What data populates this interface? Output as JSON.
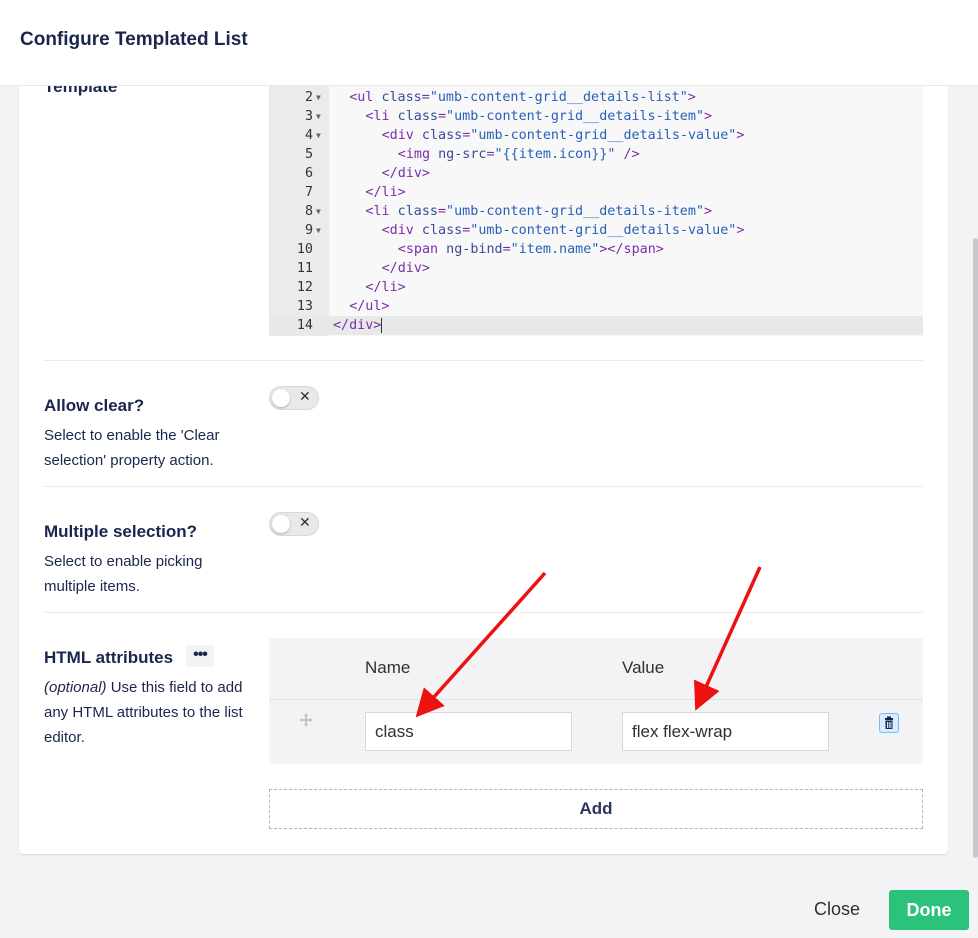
{
  "dialog": {
    "title": "Configure Templated List"
  },
  "template": {
    "label": "Template",
    "lines": [
      {
        "n": "2",
        "fold": true,
        "indent": 1,
        "parts": [
          [
            "tag",
            "<ul"
          ],
          [
            "sp",
            " "
          ],
          [
            "attr",
            "class"
          ],
          [
            "tag",
            "="
          ],
          [
            "str",
            "\"umb-content-grid__details-list\""
          ],
          [
            "tag",
            ">"
          ]
        ]
      },
      {
        "n": "3",
        "fold": true,
        "indent": 2,
        "parts": [
          [
            "tag",
            "<li"
          ],
          [
            "sp",
            " "
          ],
          [
            "attr",
            "class"
          ],
          [
            "tag",
            "="
          ],
          [
            "str",
            "\"umb-content-grid__details-item\""
          ],
          [
            "tag",
            ">"
          ]
        ]
      },
      {
        "n": "4",
        "fold": true,
        "indent": 3,
        "parts": [
          [
            "tag",
            "<div"
          ],
          [
            "sp",
            " "
          ],
          [
            "attr",
            "class"
          ],
          [
            "tag",
            "="
          ],
          [
            "str",
            "\"umb-content-grid__details-value\""
          ],
          [
            "tag",
            ">"
          ]
        ]
      },
      {
        "n": "5",
        "fold": false,
        "indent": 4,
        "parts": [
          [
            "tag",
            "<img"
          ],
          [
            "sp",
            " "
          ],
          [
            "attr",
            "ng-src"
          ],
          [
            "tag",
            "="
          ],
          [
            "str",
            "\"{{item.icon}}\""
          ],
          [
            "sp",
            " "
          ],
          [
            "tag",
            "/>"
          ]
        ]
      },
      {
        "n": "6",
        "fold": false,
        "indent": 3,
        "parts": [
          [
            "tag",
            "</div>"
          ]
        ]
      },
      {
        "n": "7",
        "fold": false,
        "indent": 2,
        "parts": [
          [
            "tag",
            "</li>"
          ]
        ]
      },
      {
        "n": "8",
        "fold": true,
        "indent": 2,
        "parts": [
          [
            "tag",
            "<li"
          ],
          [
            "sp",
            " "
          ],
          [
            "attr",
            "class"
          ],
          [
            "tag",
            "="
          ],
          [
            "str",
            "\"umb-content-grid__details-item\""
          ],
          [
            "tag",
            ">"
          ]
        ]
      },
      {
        "n": "9",
        "fold": true,
        "indent": 3,
        "parts": [
          [
            "tag",
            "<div"
          ],
          [
            "sp",
            " "
          ],
          [
            "attr",
            "class"
          ],
          [
            "tag",
            "="
          ],
          [
            "str",
            "\"umb-content-grid__details-value\""
          ],
          [
            "tag",
            ">"
          ]
        ]
      },
      {
        "n": "10",
        "fold": false,
        "indent": 4,
        "parts": [
          [
            "tag",
            "<span"
          ],
          [
            "sp",
            " "
          ],
          [
            "attr",
            "ng-bind"
          ],
          [
            "tag",
            "="
          ],
          [
            "str",
            "\"item.name\""
          ],
          [
            "tag",
            "></span>"
          ]
        ]
      },
      {
        "n": "11",
        "fold": false,
        "indent": 3,
        "parts": [
          [
            "tag",
            "</div>"
          ]
        ]
      },
      {
        "n": "12",
        "fold": false,
        "indent": 2,
        "parts": [
          [
            "tag",
            "</li>"
          ]
        ]
      },
      {
        "n": "13",
        "fold": false,
        "indent": 1,
        "parts": [
          [
            "tag",
            "</ul>"
          ]
        ]
      },
      {
        "n": "14",
        "fold": false,
        "indent": 0,
        "active": true,
        "parts": [
          [
            "tag",
            "</div>"
          ]
        ]
      }
    ]
  },
  "allow_clear": {
    "label": "Allow clear?",
    "description": "Select to enable the 'Clear selection' property action.",
    "toggle_icon": "close-icon",
    "value": false
  },
  "multiple_selection": {
    "label": "Multiple selection?",
    "description": "Select to enable picking multiple items.",
    "toggle_icon": "close-icon",
    "value": false
  },
  "html_attributes": {
    "label": "HTML attributes",
    "menu_label": "•••",
    "optional": "(optional)",
    "description": " Use this field to add any HTML attributes to the list editor.",
    "col_name": "Name",
    "col_value": "Value",
    "rows": [
      {
        "name": "class",
        "value": "flex flex-wrap"
      }
    ],
    "add_label": "Add"
  },
  "footer": {
    "close_label": "Close",
    "done_label": "Done",
    "done_color": "#2bc37c"
  },
  "annotation_color": "#ee1111"
}
